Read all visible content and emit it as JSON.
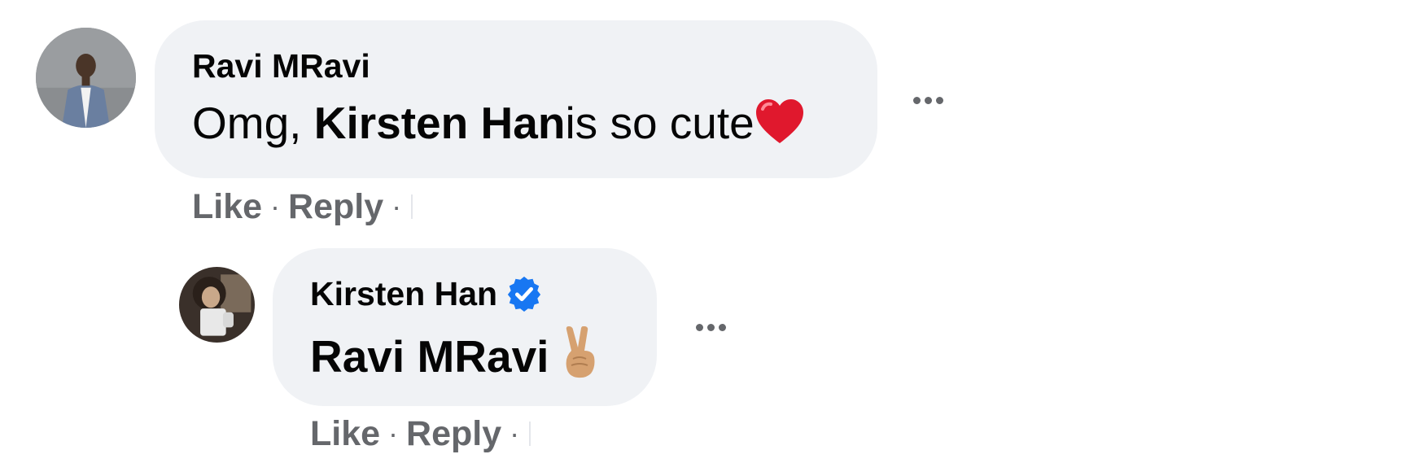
{
  "comments": [
    {
      "author": "Ravi MRavi",
      "text_prefix": "Omg, ",
      "mention": "Kirsten Han",
      "text_suffix": "is so cute",
      "emoji": "red-heart",
      "actions": {
        "like": "Like",
        "separator": "·",
        "reply": "Reply"
      }
    }
  ],
  "reply": {
    "author": "Kirsten Han",
    "verified": true,
    "text": "Ravi MRavi",
    "emoji": "victory-hand",
    "actions": {
      "like": "Like",
      "separator": "·",
      "reply": "Reply"
    }
  },
  "colors": {
    "bubble": "#f0f2f5",
    "meta_text": "#65676b",
    "verified_badge": "#1877f2",
    "heart": "#e0182d"
  }
}
